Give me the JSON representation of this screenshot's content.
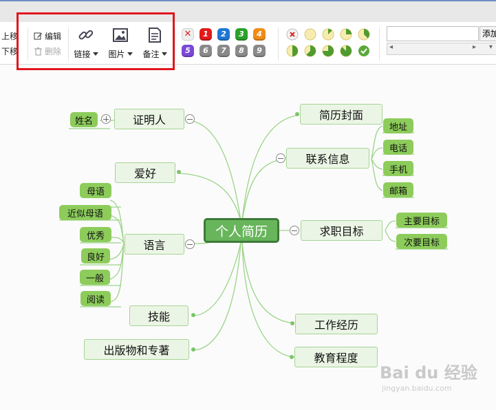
{
  "toolbar": {
    "move_up_label": "上移",
    "move_down_label": "下移",
    "edit_label": "编辑",
    "delete_label": "删除",
    "link_label": "链接",
    "image_label": "图片",
    "note_label": "备注",
    "priorities": [
      "1",
      "2",
      "3",
      "4",
      "5",
      "6",
      "7",
      "8",
      "9"
    ],
    "priority_colors": [
      "#e11b1b",
      "#1f77d4",
      "#2aa12a",
      "#f08c16",
      "#7b49d8",
      "#8a8a8a",
      "#8a8a8a",
      "#8a8a8a",
      "#8a8a8a"
    ],
    "progress_icons": [
      "progress-clear-icon",
      "progress-0-icon",
      "progress-1-icon",
      "progress-2-icon",
      "progress-3-icon",
      "progress-4-icon",
      "progress-5-icon",
      "progress-6-icon",
      "progress-7-icon",
      "progress-done-icon"
    ],
    "add_button_label": "添加"
  },
  "mindmap": {
    "root": "个人简历",
    "nodes": {
      "proof": "证明人",
      "name": "姓名",
      "hobby": "爱好",
      "language": "语言",
      "mother_tongue": "母语",
      "near_native": "近似母语",
      "excellent": "优秀",
      "good": "良好",
      "average": "一般",
      "reading": "阅读",
      "skills": "技能",
      "publications": "出版物和专著",
      "cover": "简历封面",
      "contact": "联系信息",
      "address": "地址",
      "phone": "电话",
      "mobile": "手机",
      "email": "邮箱",
      "objective": "求职目标",
      "main_goal": "主要目标",
      "secondary_goal": "次要目标",
      "work": "工作经历",
      "education": "教育程度"
    }
  },
  "watermark": {
    "brand": "Bai du 经验",
    "url": "jingyan.baidu.com"
  },
  "colors": {
    "accent_green": "#68b55c",
    "highlight_red": "#e0161d"
  }
}
